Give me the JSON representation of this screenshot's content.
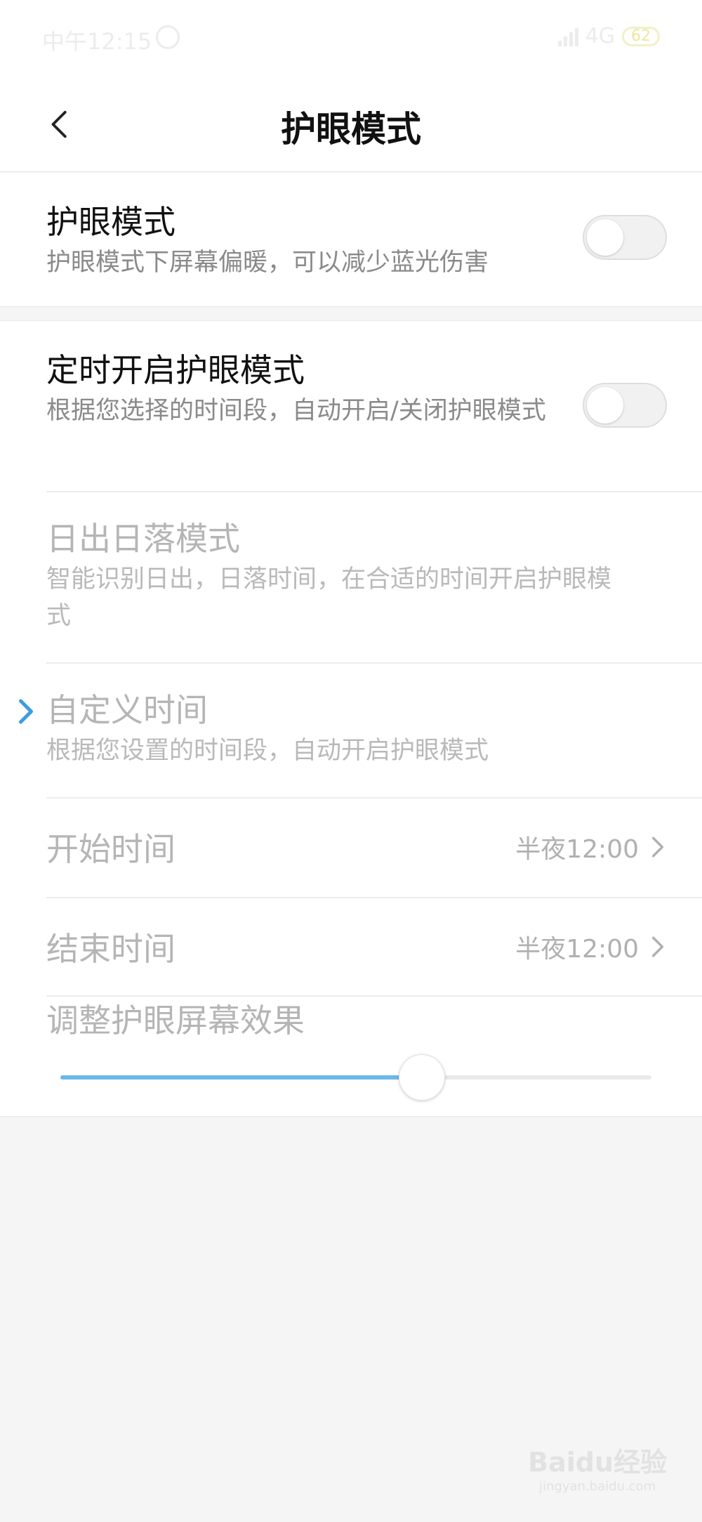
{
  "status_bar": {
    "time": "中午12:15",
    "network": "4G",
    "battery": "62"
  },
  "header": {
    "title": "护眼模式"
  },
  "eye_mode": {
    "title": "护眼模式",
    "subtitle": "护眼模式下屏幕偏暖，可以减少蓝光伤害",
    "enabled": false
  },
  "schedule": {
    "title": "定时开启护眼模式",
    "subtitle": "根据您选择的时间段，自动开启/关闭护眼模式",
    "enabled": false
  },
  "sunrise": {
    "title": "日出日落模式",
    "subtitle": "智能识别日出，日落时间，在合适的时间开启护眼模式"
  },
  "custom": {
    "title": "自定义时间",
    "subtitle": "根据您设置的时间段，自动开启护眼模式",
    "selected": true
  },
  "start_time": {
    "label": "开始时间",
    "value": "半夜12:00"
  },
  "end_time": {
    "label": "结束时间",
    "value": "半夜12:00"
  },
  "effect": {
    "label": "调整护眼屏幕效果",
    "level": 0.61
  },
  "colors": {
    "accent": "#6bb8ea",
    "selected_chevron": "#3a9de0"
  },
  "watermark": {
    "brand": "Baidu经验",
    "site": "jingyan.baidu.com"
  }
}
